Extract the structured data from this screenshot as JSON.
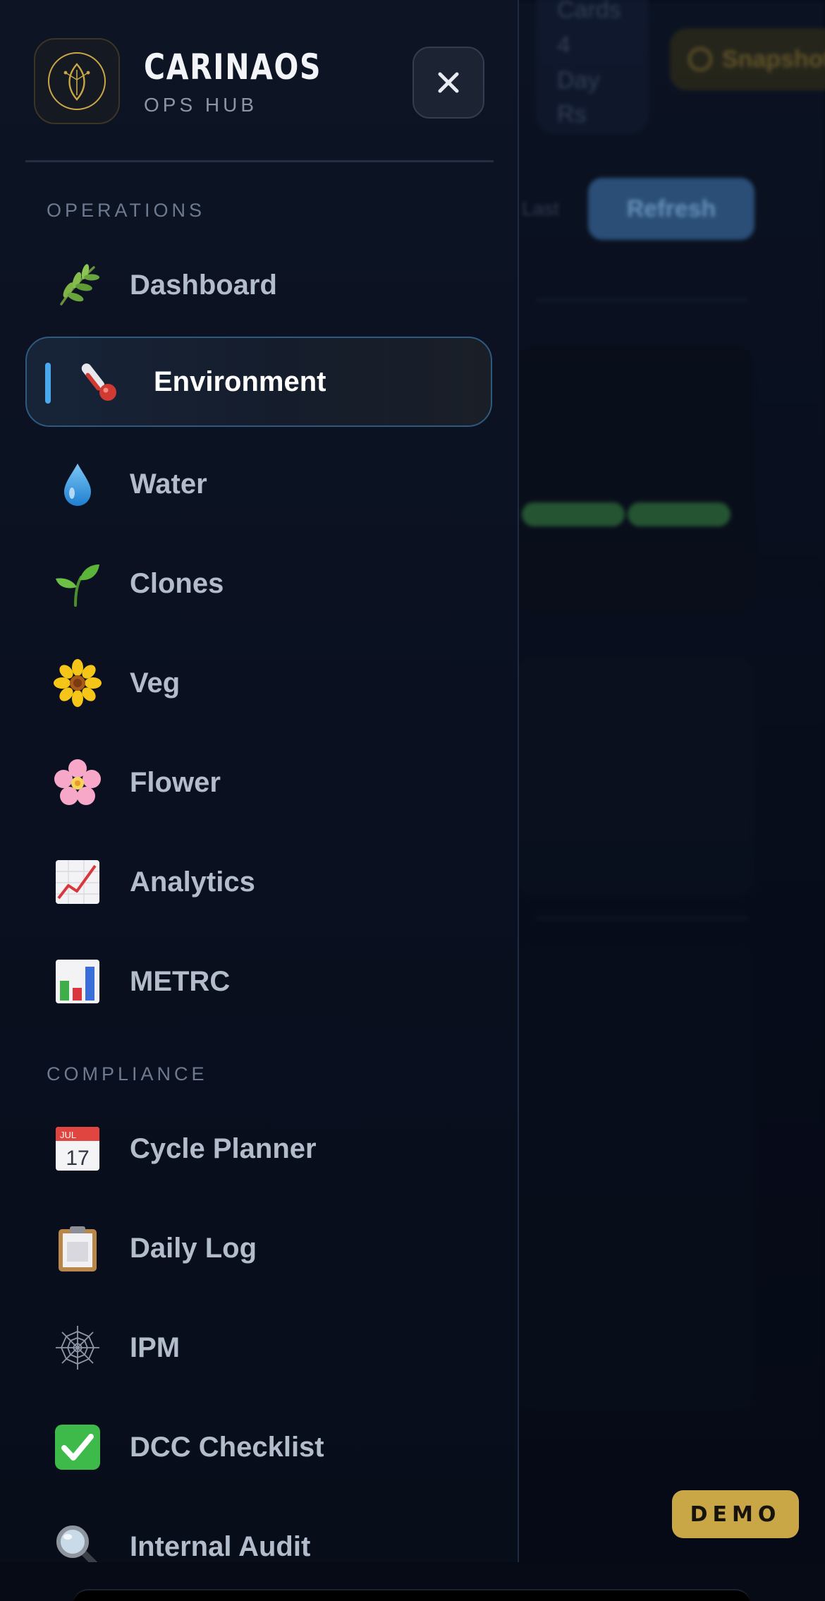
{
  "brand": {
    "name": "CARINAOS",
    "subtitle": "OPS HUB",
    "logo_icon": "leaf-emblem-icon",
    "accent_color": "#c9a646"
  },
  "drawer": {
    "close_icon": "close-icon",
    "sections": [
      {
        "label": "OPERATIONS",
        "items": [
          {
            "label": "Dashboard",
            "icon": "herb-icon",
            "active": false
          },
          {
            "label": "Environment",
            "icon": "thermometer-icon",
            "active": true
          },
          {
            "label": "Water",
            "icon": "droplet-icon",
            "active": false
          },
          {
            "label": "Clones",
            "icon": "seedling-icon",
            "active": false
          },
          {
            "label": "Veg",
            "icon": "sunflower-icon",
            "active": false
          },
          {
            "label": "Flower",
            "icon": "cherry-blossom-icon",
            "active": false
          },
          {
            "label": "Analytics",
            "icon": "chart-increasing-icon",
            "active": false
          },
          {
            "label": "METRC",
            "icon": "bar-chart-icon",
            "active": false
          }
        ]
      },
      {
        "label": "COMPLIANCE",
        "items": [
          {
            "label": "Cycle Planner",
            "icon": "calendar-icon",
            "calendar_month": "JUL",
            "calendar_day": "17",
            "active": false
          },
          {
            "label": "Daily Log",
            "icon": "clipboard-icon",
            "active": false
          },
          {
            "label": "IPM",
            "icon": "spider-web-icon",
            "active": false
          },
          {
            "label": "DCC Checklist",
            "icon": "check-mark-icon",
            "active": false
          },
          {
            "label": "Internal Audit",
            "icon": "magnifying-glass-icon",
            "active": false
          }
        ]
      }
    ]
  },
  "background": {
    "refresh_label": "Refresh",
    "shape_button_label": "Snapshot",
    "ghost_lines": [
      "Cards",
      "4",
      "Day",
      "Rs"
    ],
    "ghost_side_label": "Last"
  },
  "demo_badge": "DEMO",
  "colors": {
    "active_border": "#2f5a80",
    "active_bar": "#4aa8ec",
    "nav_text": "#b3bcca",
    "section_text": "#6d7a90"
  }
}
